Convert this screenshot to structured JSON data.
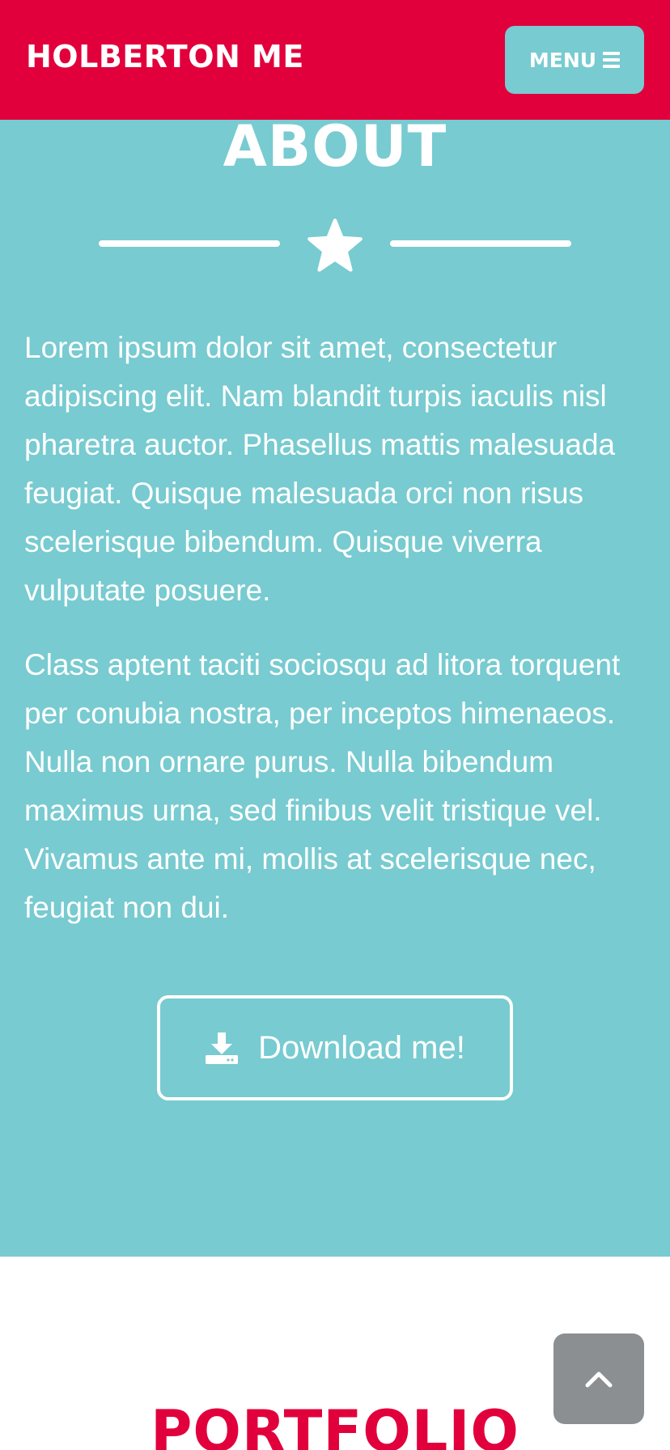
{
  "navbar": {
    "brand": "HOLBERTON ME",
    "menu_label": "MENU",
    "menu_icon": "bars-icon"
  },
  "about": {
    "title": "ABOUT",
    "divider_icon": "star-icon",
    "paragraphs": [
      "Lorem ipsum dolor sit amet, consectetur adipiscing elit. Nam blandit turpis iaculis nisl pharetra auctor. Phasellus mattis malesuada feugiat. Quisque malesuada orci non risus scelerisque bibendum. Quisque viverra vulputate posuere.",
      "Class aptent taciti sociosqu ad litora torquent per conubia nostra, per inceptos himenaeos. Nulla non ornare purus. Nulla bibendum maximus urna, sed finibus velit tristique vel. Vivamus ante mi, mollis at scelerisque nec, feugiat non dui."
    ],
    "download_label": "Download me!",
    "download_icon": "download-icon"
  },
  "portfolio": {
    "title": "PORTFOLIO"
  },
  "scroll_top": {
    "icon": "chevron-up-icon"
  },
  "colors": {
    "primary": "#e1003c",
    "accent": "#78cbd0",
    "scroll_button": "#8c8f91",
    "text_light": "#ffffff"
  }
}
